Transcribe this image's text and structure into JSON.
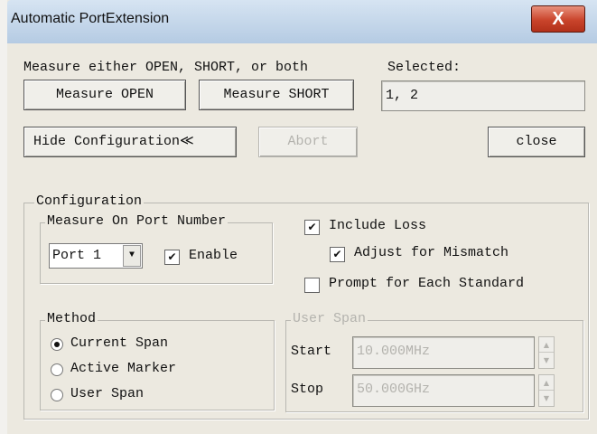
{
  "window": {
    "title": "Automatic PortExtension",
    "close_glyph": "X"
  },
  "measure": {
    "instruction": "Measure either OPEN, SHORT, or both",
    "open_button": "Measure OPEN",
    "short_button": "Measure SHORT",
    "selected_label": "Selected:",
    "selected_value": "1, 2"
  },
  "actions": {
    "hide_config_button": "Hide Configuration≪",
    "abort_button": "Abort",
    "close_button": "close"
  },
  "configuration": {
    "legend": "Configuration",
    "port_group": {
      "legend": "Measure On Port Number",
      "port_selected": "Port 1",
      "enable_label": "Enable",
      "enable_checked": true
    },
    "include_loss": {
      "label": "Include Loss",
      "checked": true
    },
    "adjust_mismatch": {
      "label": "Adjust for Mismatch",
      "checked": true
    },
    "prompt_each": {
      "label": "Prompt for Each Standard",
      "checked": false
    },
    "method": {
      "legend": "Method",
      "options": [
        {
          "label": "Current Span",
          "selected": true
        },
        {
          "label": "Active Marker",
          "selected": false
        },
        {
          "label": "User Span",
          "selected": false
        }
      ]
    },
    "user_span": {
      "legend": "User Span",
      "start_label": "Start",
      "start_value": "10.000MHz",
      "stop_label": "Stop",
      "stop_value": "50.000GHz"
    }
  },
  "icons": {
    "check": "✔",
    "dropdown": "▼",
    "spin_up": "▲",
    "spin_down": "▼"
  }
}
